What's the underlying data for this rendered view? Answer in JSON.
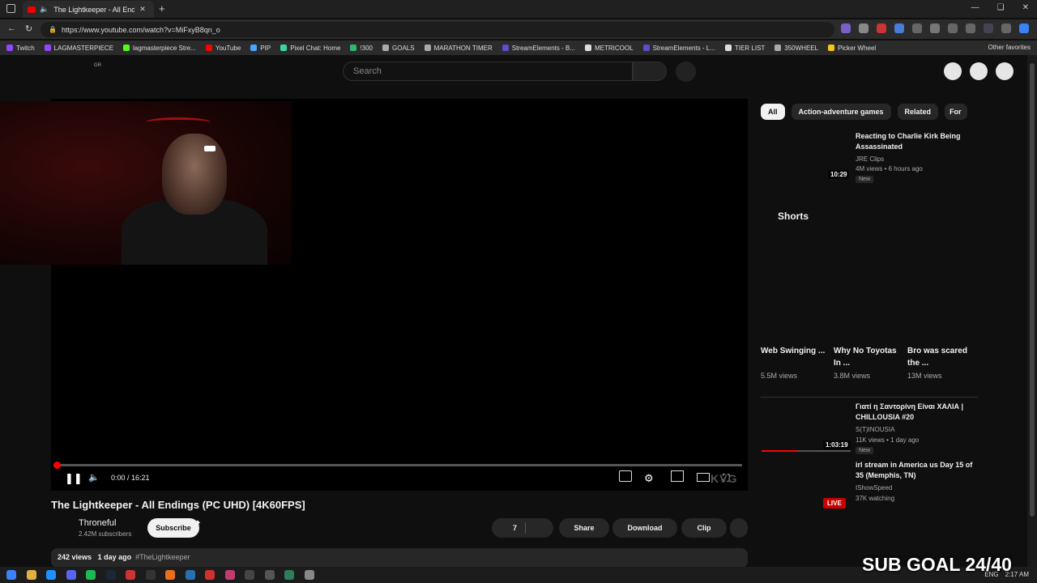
{
  "browser": {
    "tab_title": "The Lightkeeper - All Endings (P",
    "url": "https://www.youtube.com/watch?v=MiFxyB8qn_o",
    "bookmarks": [
      {
        "label": "Twitch",
        "color": "#9146ff"
      },
      {
        "label": "LAGMASTERPIECE",
        "color": "#9146ff"
      },
      {
        "label": "lagmasterpiece Stre...",
        "color": "#53fc18"
      },
      {
        "label": "YouTube",
        "color": "#ff0000"
      },
      {
        "label": "PIP",
        "color": "#4aa3ff"
      },
      {
        "label": "Pixel Chat: Home",
        "color": "#3ad6a0"
      },
      {
        "label": "!300",
        "color": "#2eb872"
      },
      {
        "label": "GOALS",
        "color": "#aaaaaa"
      },
      {
        "label": "MARATHON TIMER",
        "color": "#aaaaaa"
      },
      {
        "label": "StreamElements - B...",
        "color": "#5a4fcf"
      },
      {
        "label": "METRICOOL",
        "color": "#dddddd"
      },
      {
        "label": "StreamElements - L...",
        "color": "#5a4fcf"
      },
      {
        "label": "TIER LIST",
        "color": "#dddddd"
      },
      {
        "label": "350WHEEL",
        "color": "#aaaaaa"
      },
      {
        "label": "Picker Wheel",
        "color": "#f5c518"
      }
    ],
    "other_favorites": "Other favorites"
  },
  "header": {
    "logo_sub": "GR",
    "search_placeholder": "Search"
  },
  "player": {
    "time": "0:00 / 16:21",
    "progress_fraction": 0.0,
    "watermark": "KVG"
  },
  "video": {
    "title": "The Lightkeeper - All Endings (PC UHD) [4K60FPS]",
    "channel": "Throneful",
    "subscribers": "2.42M subscribers",
    "subscribe_label": "Subscribe",
    "likes": "7",
    "share_label": "Share",
    "download_label": "Download",
    "clip_label": "Clip",
    "views": "242 views",
    "age": "1 day ago",
    "hashtag": "#TheLightkeeper"
  },
  "sidebar": {
    "chips": [
      "All",
      "Action-adventure games",
      "Related",
      "For"
    ],
    "videos": [
      {
        "title": "Reacting to Charlie Kirk Being Assassinated",
        "channel": "JRE Clips",
        "meta": "4M views • 6 hours ago",
        "duration": "10:29",
        "badge": "New"
      },
      {
        "title": "Γιατί η Σαντορίνη Είναι ΧΑΛΙΑ | CHILLOUSIA #20",
        "channel": "S(T)INOUSIA",
        "meta": "11K views • 1 day ago",
        "duration": "1:03:19",
        "badge": "New"
      },
      {
        "title": "irl stream in America us Day 15 of 35 (Memphis, TN)",
        "channel": "IShowSpeed",
        "meta": "37K watching",
        "badge": "LIVE"
      }
    ],
    "shorts_heading": "Shorts",
    "shorts": [
      {
        "title": "Web Swinging ...",
        "views": "5.5M views"
      },
      {
        "title": "Why No Toyotas In ...",
        "views": "3.8M views"
      },
      {
        "title": "Bro was scared the ...",
        "views": "13M views"
      }
    ]
  },
  "overlay": {
    "sub_goal": "SUB GOAL 24/40"
  },
  "taskbar": {
    "lang": "ENG",
    "clock": "2:17 AM"
  },
  "colors": {
    "accent": "#ff0000",
    "background": "#0f0f0f"
  }
}
